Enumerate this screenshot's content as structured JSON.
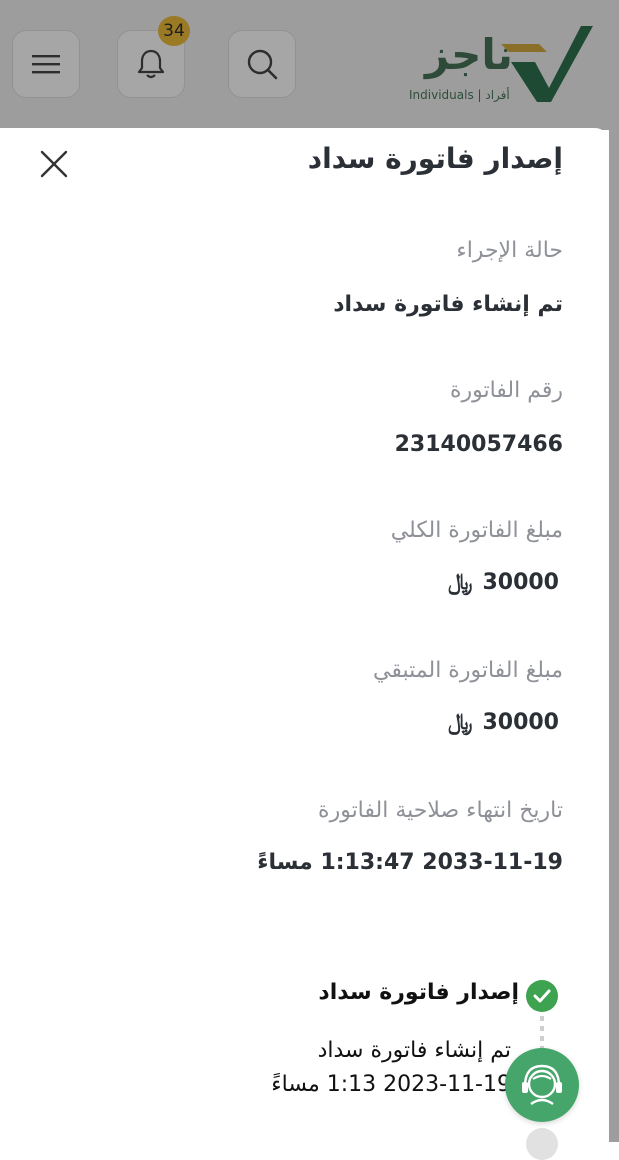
{
  "header": {
    "notification_count": "34",
    "brand_arabic": "ناجز",
    "brand_english": "Individuals | أفراد"
  },
  "sheet": {
    "title": "إصدار فاتورة سداد",
    "fields": [
      {
        "label": "حالة الإجراء",
        "value": "تم إنشاء فاتورة سداد"
      },
      {
        "label": "رقم الفاتورة",
        "value": "23140057466"
      },
      {
        "label": "مبلغ الفاتورة الكلي",
        "value": "30000",
        "currency": "﷼"
      },
      {
        "label": "مبلغ الفاتورة المتبقي",
        "value": "30000",
        "currency": "﷼"
      },
      {
        "label": "تاريخ انتهاء صلاحية الفاتورة",
        "value": "2033-11-19 1:13:47 مساءً"
      }
    ]
  },
  "timeline": {
    "step_title": "إصدار فاتورة سداد",
    "step_desc": "تم إنشاء فاتورة سداد",
    "step_date": "2023-11-19 1:13 مساءً"
  },
  "colors": {
    "brand_green": "#2e4a39",
    "badge": "#9a7a24",
    "check_green": "#3da351",
    "support_green": "#46a56a"
  },
  "icons": [
    "menu-icon",
    "bell-icon",
    "search-icon",
    "logo-check-icon",
    "close-icon",
    "check-icon",
    "support-agent-icon"
  ]
}
